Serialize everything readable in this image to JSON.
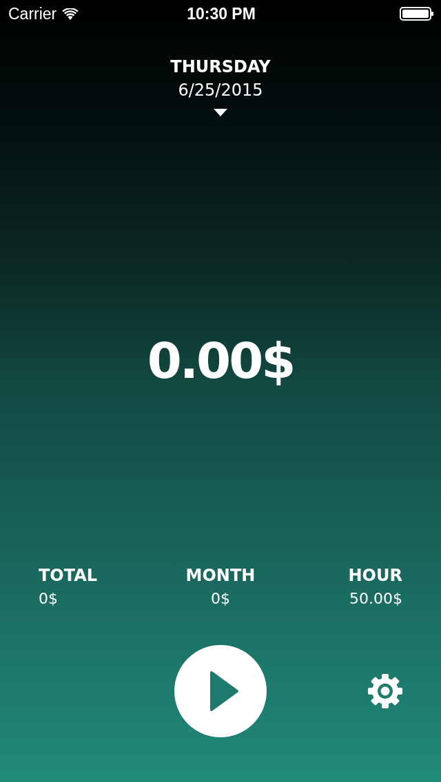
{
  "status_bar": {
    "carrier": "Carrier",
    "time": "10:30 PM"
  },
  "date": {
    "weekday": "THURSDAY",
    "date": "6/25/2015"
  },
  "amount": "0.00$",
  "stats": [
    {
      "label": "TOTAL",
      "value": "0$"
    },
    {
      "label": "MONTH",
      "value": "0$"
    },
    {
      "label": "HOUR",
      "value": "50.00$"
    }
  ]
}
